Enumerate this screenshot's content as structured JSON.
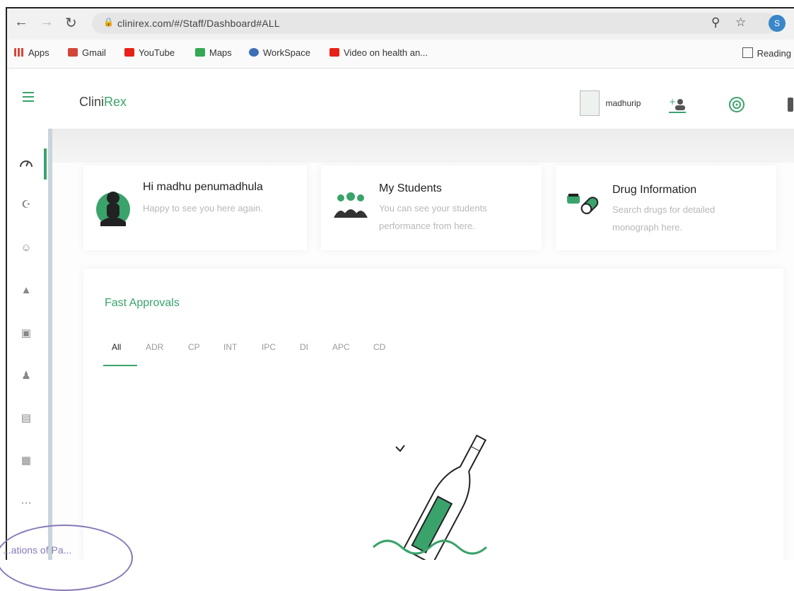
{
  "browser": {
    "url": "clinirex.com/#/Staff/Dashboard#ALL",
    "profile_initial": "S"
  },
  "bookmarks": [
    {
      "label": "Apps",
      "color": "#d44638"
    },
    {
      "label": "Gmail",
      "color": "#d44638"
    },
    {
      "label": "YouTube",
      "color": "#e62117"
    },
    {
      "label": "Maps",
      "color": "#34a853"
    },
    {
      "label": "WorkSpace",
      "color": "#3b6fb6"
    },
    {
      "label": "Video on health an...",
      "color": "#e62117"
    }
  ],
  "reading_list_label": "Reading",
  "header": {
    "brand_prefix": "Clini",
    "brand_accent": "Rex",
    "username": "madhurip",
    "accent_color": "#3aa36b"
  },
  "cards": {
    "welcome": {
      "title": "Hi madhu penumadhula",
      "subtitle": "Happy to see you here again."
    },
    "students": {
      "title": "My Students",
      "subtitle_line1": "You can see your students",
      "subtitle_line2": "performance from here."
    },
    "drugs": {
      "title": "Drug Information",
      "subtitle_line1": "Search drugs for detailed",
      "subtitle_line2": "monograph here."
    }
  },
  "approvals": {
    "title": "Fast Approvals",
    "tabs": [
      "All",
      "ADR",
      "CP",
      "INT",
      "IPC",
      "DI",
      "APC",
      "CD"
    ],
    "active_tab": "All"
  },
  "stamp_text": "...ations of Pa..."
}
